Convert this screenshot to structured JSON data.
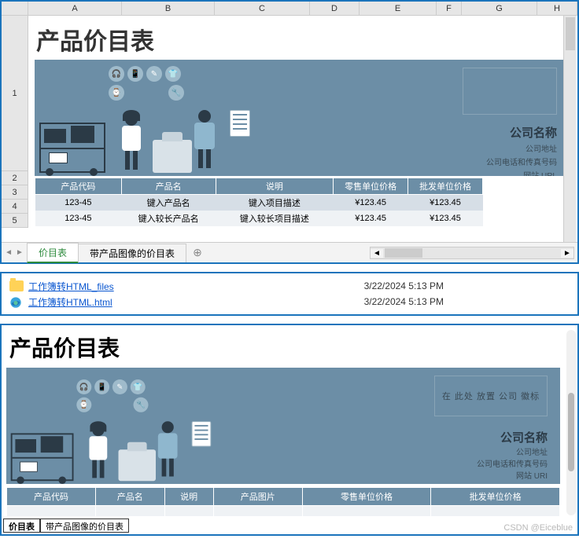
{
  "excel": {
    "columns": [
      "A",
      "B",
      "C",
      "D",
      "E",
      "F",
      "G",
      "H"
    ],
    "rows": [
      "1",
      "2",
      "3",
      "4",
      "5"
    ],
    "title": "产品价目表",
    "company": {
      "name": "公司名称",
      "addr": "公司地址",
      "phone": "公司电话和传真号码",
      "url": "网站 URL"
    },
    "headers": [
      "产品代码",
      "产品名",
      "说明",
      "零售单位价格",
      "批发单位价格"
    ],
    "data": [
      {
        "code": "123-45",
        "name": "键入产品名",
        "desc": "键入项目描述",
        "retail": "¥123.45",
        "wholesale": "¥123.45"
      },
      {
        "code": "123-45",
        "name": "键入较长产品名",
        "desc": "键入较长项目描述",
        "retail": "¥123.45",
        "wholesale": "¥123.45"
      }
    ],
    "tabs": {
      "active": "价目表",
      "other": "带产品图像的价目表",
      "add": "⊕"
    }
  },
  "files": [
    {
      "icon": "folder",
      "name": "工作簿转HTML_files",
      "date": "3/22/2024 5:13 PM"
    },
    {
      "icon": "edge",
      "name": "工作簿转HTML.html",
      "date": "3/22/2024 5:13 PM"
    }
  ],
  "preview": {
    "title": "产品价目表",
    "placeholder": "在 此处 放置 公司 徽标",
    "company": {
      "name": "公司名称",
      "addr": "公司地址",
      "phone": "公司电话和传真号码",
      "url": "网站 URI"
    },
    "headers": [
      "产品代码",
      "产品名",
      "说明",
      "产品图片",
      "零售单位价格",
      "批发单位价格"
    ],
    "tabs": {
      "t1": "价目表",
      "t2": "带产品图像的价目表"
    }
  },
  "watermark": "CSDN @Eiceblue"
}
